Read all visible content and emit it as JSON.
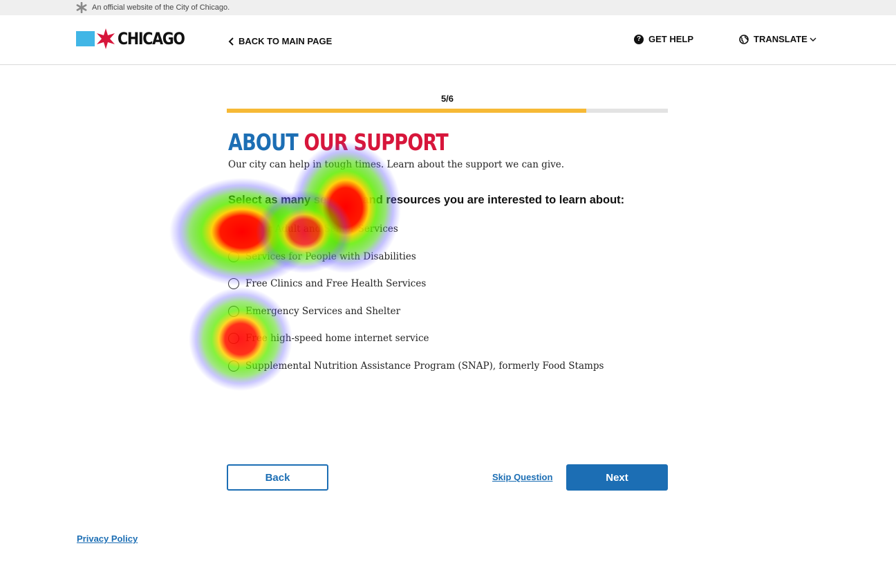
{
  "topbar": {
    "official_text": "An official website of the City of Chicago."
  },
  "header": {
    "logo_text": "CHICAGO",
    "back_main": "BACK TO MAIN PAGE",
    "get_help": "GET HELP",
    "translate": "TRANSLATE"
  },
  "progress": {
    "label": "5/6",
    "fraction": 0.815
  },
  "form": {
    "title_part1": "ABOUT",
    "title_part2": "OUR SUPPORT",
    "subtitle": "Our city can help in tough times. Learn about the support we can give.",
    "question": "Select as many services and resources you are interested to learn about:",
    "options": [
      {
        "label": "Older Adult and Senior Services"
      },
      {
        "label": "Services for People with Disabilities"
      },
      {
        "label": "Free Clinics and Free Health Services"
      },
      {
        "label": "Emergency Services and Shelter"
      },
      {
        "label": "Free high-speed home internet service"
      },
      {
        "label": "Supplemental Nutrition Assistance Program (SNAP), formerly Food Stamps"
      }
    ]
  },
  "actions": {
    "back": "Back",
    "skip": "Skip Question",
    "next": "Next"
  },
  "footer": {
    "privacy": "Privacy Policy"
  },
  "colors": {
    "brand_blue": "#1c6eb4",
    "brand_red": "#d7163b",
    "flag_blue": "#41b6e6",
    "progress_fill": "#f6b936"
  },
  "icons": {
    "topbar": "star-icon",
    "back": "chevron-left-icon",
    "help": "help-circle-icon",
    "translate": "globe-icon",
    "translate_caret": "chevron-down-icon"
  }
}
